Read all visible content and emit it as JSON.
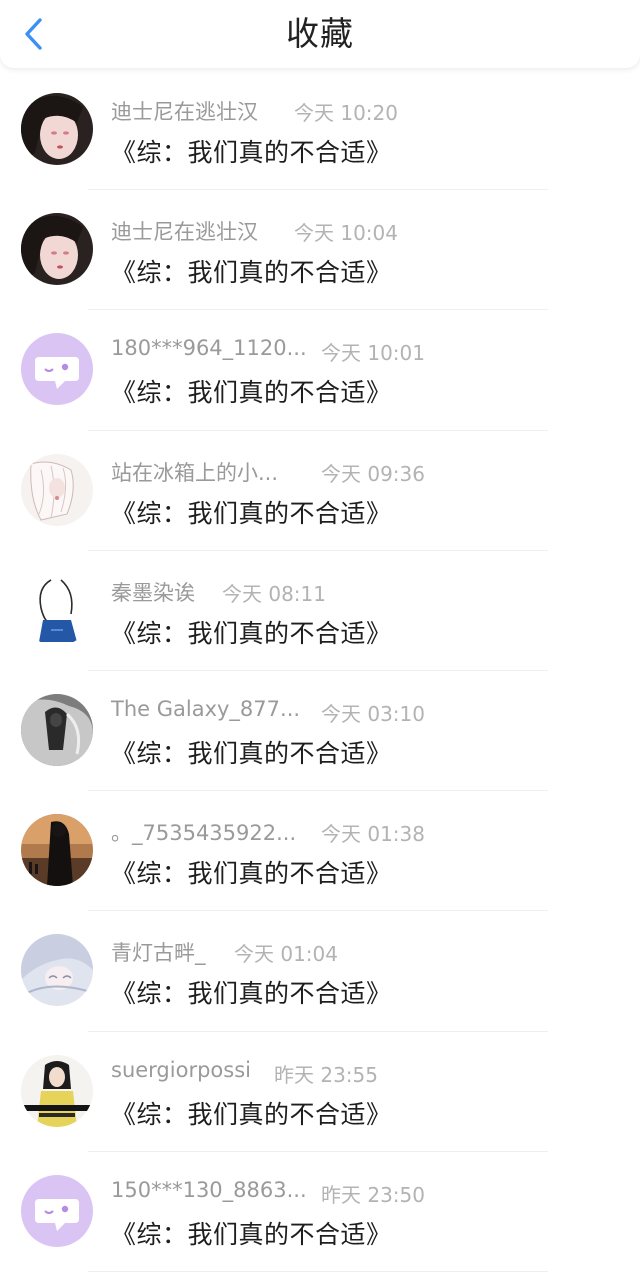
{
  "header": {
    "title": "收藏",
    "back_icon": "chevron-left-icon",
    "accent": "#3b8ff5"
  },
  "items": [
    {
      "name": "迪士尼在逃壮汉",
      "time": "今天 10:20",
      "book": "《综：我们真的不合适》"
    },
    {
      "name": "迪士尼在逃壮汉",
      "time": "今天 10:04",
      "book": "《综：我们真的不合适》"
    },
    {
      "name": "180***964_1120...",
      "time": "今天 10:01",
      "book": "《综：我们真的不合适》"
    },
    {
      "name": "站在冰箱上的小...",
      "time": "今天 09:36",
      "book": "《综：我们真的不合适》"
    },
    {
      "name": "秦墨染诶",
      "time": "今天 08:11",
      "book": "《综：我们真的不合适》"
    },
    {
      "name": "The Galaxy_877...",
      "time": "今天 03:10",
      "book": "《综：我们真的不合适》"
    },
    {
      "name": "。_7535435922...",
      "time": "今天 01:38",
      "book": "《综：我们真的不合适》"
    },
    {
      "name": "青灯古畔_",
      "time": "今天 01:04",
      "book": "《综：我们真的不合适》"
    },
    {
      "name": "suergiorpossi",
      "time": "昨天 23:55",
      "book": "《综：我们真的不合适》"
    },
    {
      "name": "150***130_8863...",
      "time": "昨天 23:50",
      "book": "《综：我们真的不合适》"
    }
  ]
}
